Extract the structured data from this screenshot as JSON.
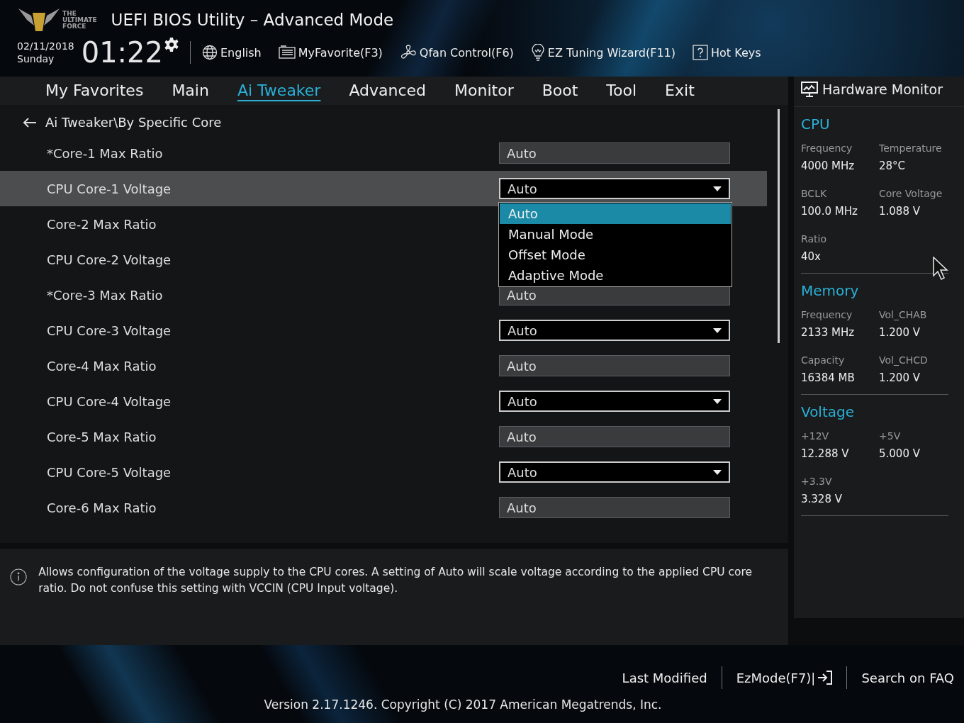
{
  "header": {
    "logo_text": [
      "THE",
      "ULTIMATE",
      "FORCE"
    ],
    "title": "UEFI BIOS Utility – Advanced Mode",
    "date": "02/11/2018",
    "day": "Sunday",
    "time": "01:22",
    "tools": [
      {
        "kind": "globe",
        "label": "English"
      },
      {
        "kind": "list",
        "label": "MyFavorite(F3)"
      },
      {
        "kind": "fan",
        "label": "Qfan Control(F6)"
      },
      {
        "kind": "bulb",
        "label": "EZ Tuning Wizard(F11)"
      },
      {
        "kind": "help",
        "label": "Hot Keys"
      }
    ]
  },
  "tabs": [
    {
      "label": "My Favorites",
      "selected": false
    },
    {
      "label": "Main",
      "selected": false
    },
    {
      "label": "Ai Tweaker",
      "selected": true
    },
    {
      "label": "Advanced",
      "selected": false
    },
    {
      "label": "Monitor",
      "selected": false
    },
    {
      "label": "Boot",
      "selected": false
    },
    {
      "label": "Tool",
      "selected": false
    },
    {
      "label": "Exit",
      "selected": false
    }
  ],
  "breadcrumb": "Ai Tweaker\\By Specific Core",
  "settings": [
    {
      "name": "*Core-1 Max Ratio",
      "kind": "text",
      "value": "Auto",
      "selected": false
    },
    {
      "name": "CPU Core-1 Voltage",
      "kind": "select",
      "value": "Auto",
      "selected": true
    },
    {
      "name": "Core-2 Max Ratio",
      "selected": false
    },
    {
      "name": "CPU Core-2 Voltage",
      "selected": false
    },
    {
      "name": "*Core-3 Max Ratio",
      "kind": "text",
      "value": "Auto",
      "selected": false
    },
    {
      "name": "CPU Core-3 Voltage",
      "kind": "select",
      "value": "Auto",
      "selected": false
    },
    {
      "name": "Core-4 Max Ratio",
      "kind": "text",
      "value": "Auto",
      "selected": false
    },
    {
      "name": "CPU Core-4 Voltage",
      "kind": "select",
      "value": "Auto",
      "selected": false
    },
    {
      "name": "Core-5 Max Ratio",
      "kind": "text",
      "value": "Auto",
      "selected": false
    },
    {
      "name": "CPU Core-5 Voltage",
      "kind": "select",
      "value": "Auto",
      "selected": false
    },
    {
      "name": "Core-6 Max Ratio",
      "kind": "text",
      "value": "Auto",
      "selected": false
    }
  ],
  "dropdown": [
    {
      "label": "Auto",
      "selected": true
    },
    {
      "label": "Manual Mode",
      "selected": false
    },
    {
      "label": "Offset Mode",
      "selected": false
    },
    {
      "label": "Adaptive Mode",
      "selected": false
    }
  ],
  "help_text": "Allows configuration of the voltage supply to the CPU cores. A setting of Auto will scale voltage according to the applied CPU core ratio.  Do not confuse this setting with VCCIN (CPU Input voltage).",
  "hardware_monitor": {
    "title": "Hardware Monitor",
    "sections": [
      {
        "title": "CPU",
        "items": [
          {
            "label": "Frequency",
            "value": "4000 MHz"
          },
          {
            "label": "Temperature",
            "value": "28°C"
          },
          {
            "label": "BCLK",
            "value": "100.0 MHz"
          },
          {
            "label": "Core Voltage",
            "value": "1.088 V"
          },
          {
            "label": "Ratio",
            "value": "40x"
          }
        ]
      },
      {
        "title": "Memory",
        "items": [
          {
            "label": "Frequency",
            "value": "2133 MHz"
          },
          {
            "label": "Vol_CHAB",
            "value": "1.200 V"
          },
          {
            "label": "Capacity",
            "value": "16384 MB"
          },
          {
            "label": "Vol_CHCD",
            "value": "1.200 V"
          }
        ]
      },
      {
        "title": "Voltage",
        "items": [
          {
            "label": "+12V",
            "value": "12.288 V"
          },
          {
            "label": "+5V",
            "value": "5.000 V"
          },
          {
            "label": "+3.3V",
            "value": "3.328 V"
          }
        ]
      }
    ]
  },
  "footer": {
    "links": [
      {
        "label": "Last Modified",
        "kind": "plain"
      },
      {
        "label": "EzMode(F7)|",
        "kind": "exit"
      },
      {
        "label": "Search on FAQ",
        "kind": "plain"
      }
    ],
    "version": "Version 2.17.1246. Copyright (C) 2017 American Megatrends, Inc."
  }
}
